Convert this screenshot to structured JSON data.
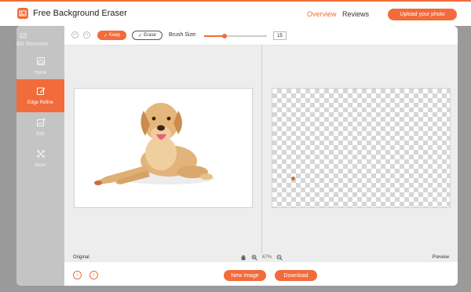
{
  "header": {
    "title": "Free Background Eraser",
    "nav": [
      "Overview",
      "Reviews"
    ],
    "upload_label": "Upload your photo"
  },
  "sidebar": {
    "brand": "BG Remover",
    "items": [
      {
        "label": "Home",
        "icon": "home-icon"
      },
      {
        "label": "Edge Refine",
        "icon": "edit-square-icon",
        "active": true
      },
      {
        "label": "Edit",
        "icon": "image-plus-icon"
      },
      {
        "label": "More",
        "icon": "expand-icon"
      }
    ]
  },
  "toolbar": {
    "keep_label": "Keep",
    "erase_label": "Erase",
    "brush_label": "Brush Size:",
    "brush_value": "15",
    "brush_fraction": 0.33
  },
  "status": {
    "original_label": "Original",
    "preview_label": "Preview",
    "zoom": "67%"
  },
  "footer": {
    "new_image_label": "New Image",
    "download_label": "Download"
  },
  "colors": {
    "accent": "#f26b3a",
    "sidebar": "#c4c4c4",
    "canvas": "#ededed"
  }
}
